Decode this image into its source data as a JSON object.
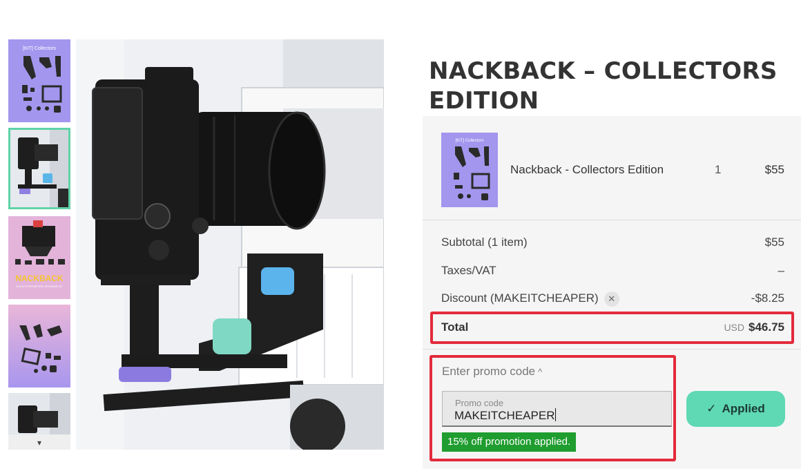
{
  "product": {
    "title": "NACKBACK – COLLECTORS EDITION"
  },
  "gallery": {
    "thumb_caption_kit": "[KIT] Collectors",
    "thumb_caption_nackback": "NACKBACK",
    "thumb_caption_nackback_sub": "ELGATO PROMPTER UPGRADE KIT",
    "thumb_down_icon": "▾",
    "selected_index": 2
  },
  "order": {
    "item_name": "Nackback - Collectors Edition",
    "item_qty": "1",
    "item_price": "$55",
    "subtotal_label": "Subtotal (1 item)",
    "subtotal_value": "$55",
    "taxes_label": "Taxes/VAT",
    "taxes_value": "–",
    "discount_label": "Discount (MAKEITCHEAPER)",
    "discount_value": "-$8.25",
    "total_label": "Total",
    "total_currency": "USD",
    "total_value": "$46.75"
  },
  "promo": {
    "toggle_label": "Enter promo code",
    "toggle_icon": "^",
    "field_label": "Promo code",
    "field_value": "MAKEITCHEAPER",
    "apply_label": "Applied",
    "apply_icon": "✓",
    "success_message": "15% off promotion applied."
  },
  "colors": {
    "accent": "#5fd8b4",
    "highlight": "#e32b3b",
    "success": "#1f9d2f",
    "thumb_purple": "#9d8fe8"
  }
}
